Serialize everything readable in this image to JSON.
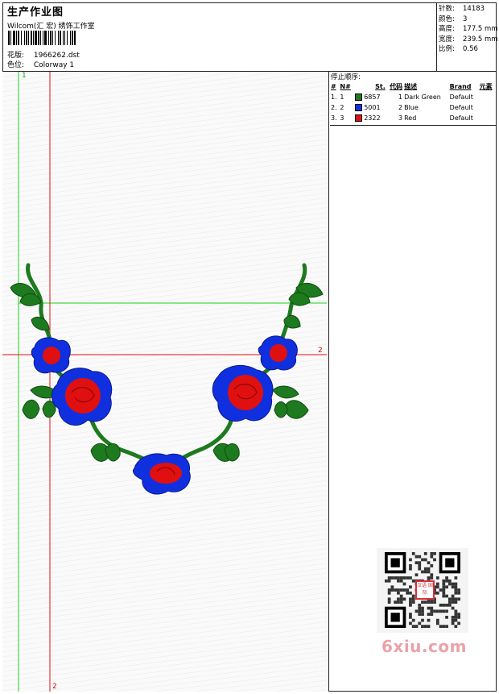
{
  "header": {
    "title": "生产作业图",
    "company": "Wilcom(汇 宏) 绣饰工作室",
    "design_label": "花版:",
    "design_value": "1966262.dst",
    "colorway_label": "色位:",
    "colorway_value": "Colorway 1"
  },
  "stats": [
    {
      "label": "针数:",
      "value": "14183"
    },
    {
      "label": "颜色:",
      "value": "3"
    },
    {
      "label": "高度:",
      "value": "177.5 mm"
    },
    {
      "label": "宽度:",
      "value": "239.5 mm"
    },
    {
      "label": "比例:",
      "value": "0.56"
    }
  ],
  "stop_sequence": {
    "title": "停止顺序:",
    "headers": [
      "#",
      "N#",
      "St.",
      "代码",
      "描述",
      "Brand",
      "元素"
    ],
    "rows": [
      {
        "index": "1.",
        "n": "1",
        "stitches": "6857",
        "code": "1",
        "description": "Dark Green",
        "brand": "Default",
        "color": "#1e7a1e"
      },
      {
        "index": "2.",
        "n": "2",
        "stitches": "5001",
        "code": "2",
        "description": "Blue",
        "brand": "Default",
        "color": "#1030e0"
      },
      {
        "index": "3.",
        "n": "3",
        "stitches": "2322",
        "code": "3",
        "description": "Red",
        "brand": "Default",
        "color": "#e01010"
      }
    ]
  },
  "guides": {
    "green_label": "1",
    "red_label_right": "2",
    "red_label_bottom": "2"
  },
  "watermark": {
    "text": "6xiu.com",
    "seal": "汉语 国际"
  },
  "colors": {
    "green_thread": "#1e7a1e",
    "blue_thread": "#1030e0",
    "red_thread": "#e01010",
    "guide_green": "#19d219",
    "guide_red": "#e01010"
  }
}
